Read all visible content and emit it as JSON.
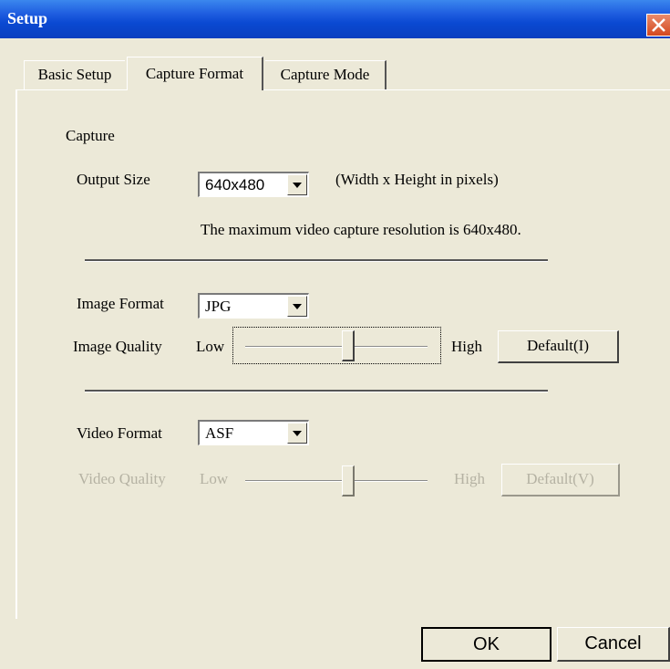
{
  "window": {
    "title": "Setup"
  },
  "tabs": [
    {
      "label": "Basic Setup"
    },
    {
      "label": "Capture Format"
    },
    {
      "label": "Capture Mode"
    }
  ],
  "capture": {
    "section_label": "Capture",
    "output_size_label": "Output Size",
    "output_size_value": "640x480",
    "output_size_hint": "(Width x Height in pixels)",
    "max_resolution_note": "The maximum video capture resolution is 640x480."
  },
  "image": {
    "format_label": "Image Format",
    "format_value": "JPG",
    "quality_label": "Image Quality",
    "low_label": "Low",
    "high_label": "High",
    "quality_level": 0.5,
    "default_button": "Default(I)"
  },
  "video": {
    "format_label": "Video Format",
    "format_value": "ASF",
    "quality_label": "Video Quality",
    "low_label": "Low",
    "high_label": "High",
    "quality_level": 0.5,
    "default_button": "Default(V)",
    "quality_enabled": false
  },
  "footer": {
    "ok_label": "OK",
    "cancel_label": "Cancel"
  },
  "colors": {
    "titlebar": "#0a49d2",
    "dialog_bg": "#ece9d8",
    "disabled_text": "#b5b2a3",
    "close_button": "#d4481e"
  }
}
